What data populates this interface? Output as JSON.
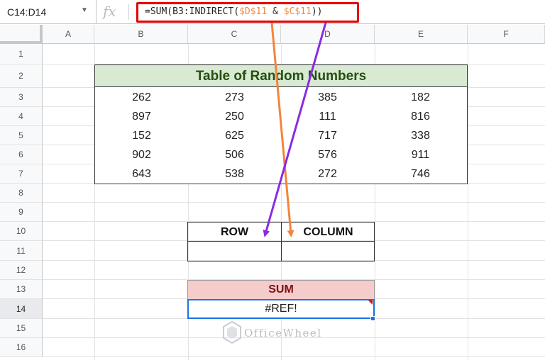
{
  "formula_bar": {
    "name_box": "C14:D14",
    "fx_label": "fx",
    "formula_parts": [
      "=SUM(B3:INDIRECT(",
      "$D$11",
      " & ",
      "$C$11",
      "))"
    ]
  },
  "columns": [
    "A",
    "B",
    "C",
    "D",
    "E",
    "F"
  ],
  "rows": [
    "1",
    "2",
    "3",
    "4",
    "5",
    "6",
    "7",
    "8",
    "9",
    "10",
    "11",
    "12",
    "13",
    "14",
    "15",
    "16"
  ],
  "table": {
    "title": "Table of Random Numbers",
    "data": [
      [
        "262",
        "273",
        "385",
        "182"
      ],
      [
        "897",
        "250",
        "111",
        "816"
      ],
      [
        "152",
        "625",
        "717",
        "338"
      ],
      [
        "902",
        "506",
        "576",
        "911"
      ],
      [
        "643",
        "538",
        "272",
        "746"
      ]
    ]
  },
  "row_col": {
    "row_label": "ROW",
    "column_label": "COLUMN"
  },
  "sum": {
    "label": "SUM",
    "value": "#REF!"
  },
  "watermark": "OfficeWheel",
  "colors": {
    "orange_arrow": "#f4843c",
    "purple_arrow": "#8a2be2",
    "formula_border": "#e60000",
    "title_bg": "#d9ead3",
    "sum_bg": "#f4cccc",
    "selection": "#1a73e8"
  }
}
